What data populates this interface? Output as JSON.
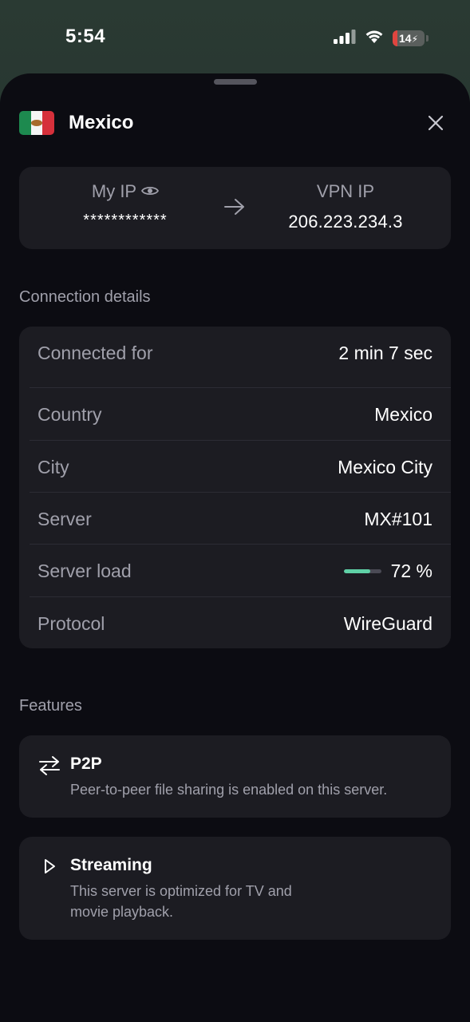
{
  "status_bar": {
    "time": "5:54",
    "battery_level": "14",
    "battery_fraction": 0.14,
    "battery_color": "#e0453f",
    "icons": [
      "cellular-signal-icon",
      "wifi-icon",
      "battery-icon",
      "charging-bolt-icon"
    ]
  },
  "header": {
    "country": "Mexico",
    "flag_icon": "mexico-flag-icon",
    "close_icon": "close-icon"
  },
  "ip_card": {
    "my_ip_label": "My IP",
    "my_ip_value": "************",
    "reveal_icon": "eye-icon",
    "arrow_icon": "arrow-right-icon",
    "vpn_ip_label": "VPN IP",
    "vpn_ip_value": "206.223.234.3"
  },
  "connection_details": {
    "title": "Connection details",
    "rows": [
      {
        "label": "Connected for",
        "value": "2 min 7 sec"
      },
      {
        "label": "Country",
        "value": "Mexico"
      },
      {
        "label": "City",
        "value": "Mexico City"
      },
      {
        "label": "Server",
        "value": "MX#101"
      },
      {
        "label": "Server load",
        "value": "72 %",
        "load_fraction": 0.72,
        "load_color": "#5fd0a6"
      },
      {
        "label": "Protocol",
        "value": "WireGuard"
      }
    ]
  },
  "features": {
    "title": "Features",
    "items": [
      {
        "icon": "p2p-arrows-icon",
        "title": "P2P",
        "description": "Peer-to-peer file sharing is enabled on this server."
      },
      {
        "icon": "play-icon",
        "title": "Streaming",
        "description_line1": "This server is optimized for TV and",
        "description_line2": "movie playback."
      }
    ]
  }
}
